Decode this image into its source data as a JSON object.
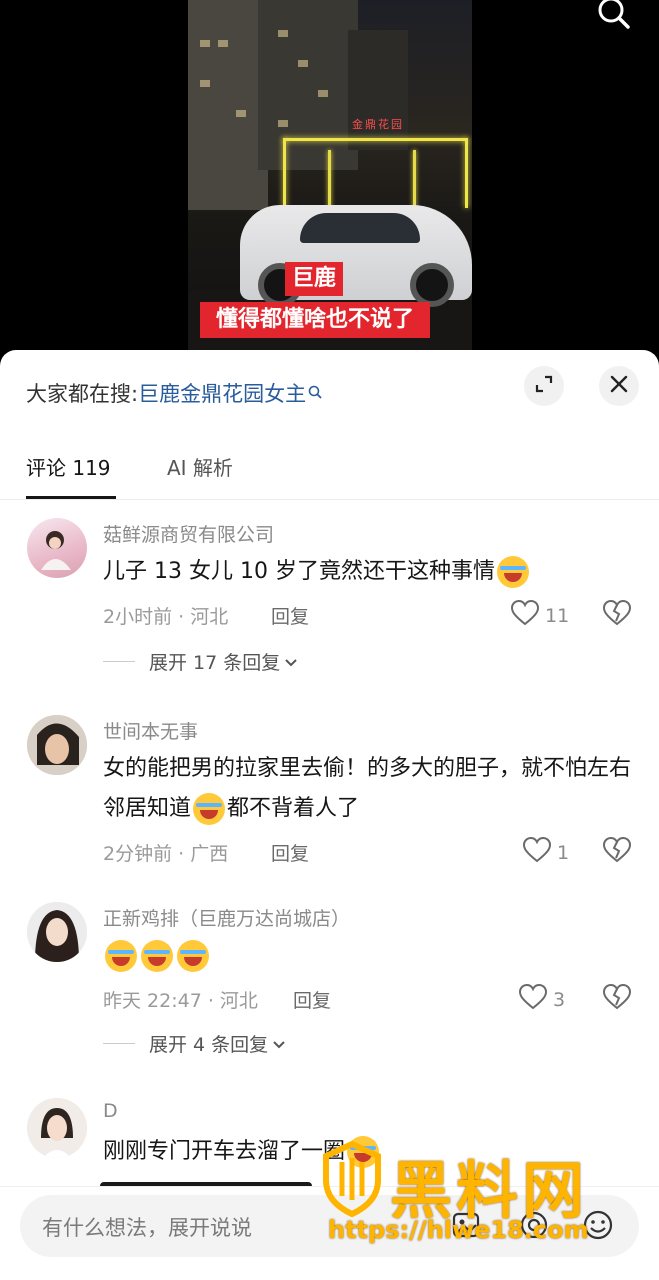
{
  "video": {
    "gate_sign": "金鼎花园",
    "caption_line1": "巨鹿",
    "caption_line2": "懂得都懂啥也不说了"
  },
  "sheet": {
    "hot_search_prefix": "大家都在搜:",
    "hot_search_keyword": "巨鹿金鼎花园女主",
    "tabs": [
      {
        "label": "评论 119",
        "active": true
      },
      {
        "label": "AI 解析",
        "active": false
      }
    ]
  },
  "comments": [
    {
      "username": "菇鲜源商贸有限公司",
      "text": "儿子 13 女儿 10 岁了竟然还干这种事情",
      "emoji_count": 1,
      "time_location": "2小时前 · 河北",
      "reply_label": "回复",
      "likes": "11",
      "expand_label": "展开 17 条回复"
    },
    {
      "username": "世间本无事",
      "text_part1": "女的能把男的拉家里去偷！的多大的胆子，就不怕左右邻居知道",
      "text_part2": "都不背着人了",
      "time_location": "2分钟前 · 广西",
      "reply_label": "回复",
      "likes": "1"
    },
    {
      "username": "正新鸡排（巨鹿万达尚城店）",
      "emoji_count": 3,
      "time_location": "昨天 22:47 · 河北",
      "reply_label": "回复",
      "likes": "3",
      "expand_label": "展开 4 条回复"
    },
    {
      "username": "D",
      "text": "刚刚专门开车去溜了一圈"
    }
  ],
  "input": {
    "placeholder": "有什么想法，展开说说"
  },
  "watermark": {
    "brand": "黑料网",
    "url": "https://hlwe18.com"
  },
  "colors": {
    "keyword_blue": "#2a5c9c",
    "caption_red": "#e3262e",
    "watermark_gold": "#ffb400"
  }
}
